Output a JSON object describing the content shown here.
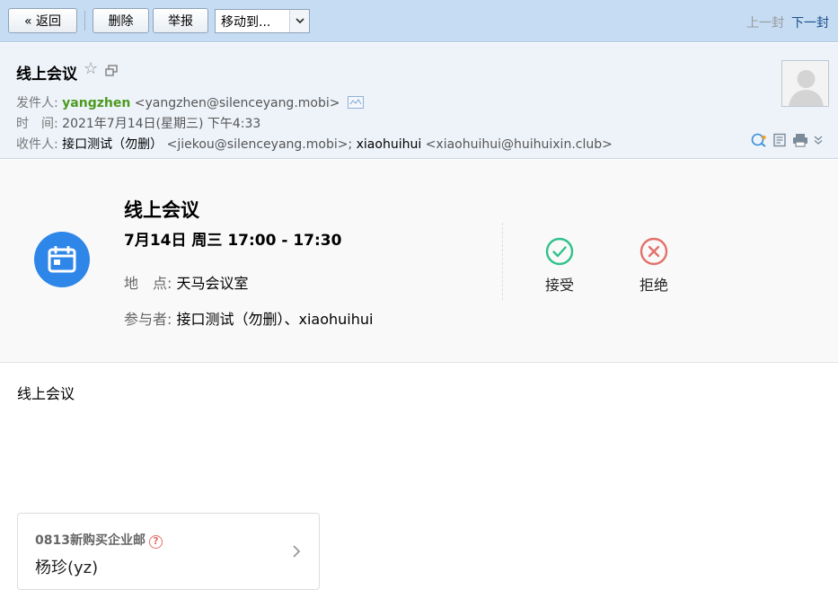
{
  "toolbar": {
    "back_label": "« 返回",
    "delete_label": "删除",
    "report_label": "举报",
    "move_to_label": "移动到...",
    "prev_label": "上一封",
    "next_label": "下一封"
  },
  "header": {
    "subject": "线上会议",
    "sender_label": "发件人:",
    "sender_name": "yangzhen",
    "sender_email": "<yangzhen@silenceyang.mobi>",
    "time_label": "时　间:",
    "time_value": "2021年7月14日(星期三) 下午4:33",
    "recipients_label": "收件人:",
    "recipient1_name": "接口测试（勿删）",
    "recipient1_email": "<jiekou@silenceyang.mobi>;",
    "recipient2_name": "xiaohuihui",
    "recipient2_email": "<xiaohuihui@huihuixin.club>"
  },
  "invite": {
    "title": "线上会议",
    "time": "7月14日 周三 17:00 - 17:30",
    "location_label": "地　点:",
    "location_value": "天马会议室",
    "attendees_label": "参与者:",
    "attendees_value": "接口测试（勿删）、xiaohuihui",
    "accept_label": "接受",
    "decline_label": "拒绝"
  },
  "body": {
    "text": "线上会议"
  },
  "signature": {
    "org": "0813新购买企业邮",
    "name": "杨珍(yz)"
  },
  "colors": {
    "toolbar_bg": "#c5dcf3",
    "header_bg": "#eef3fa",
    "sender_green": "#4c9a1e",
    "calendar_blue": "#2e86e8",
    "accept_green": "#2fc28a",
    "decline_red": "#e3716b"
  }
}
